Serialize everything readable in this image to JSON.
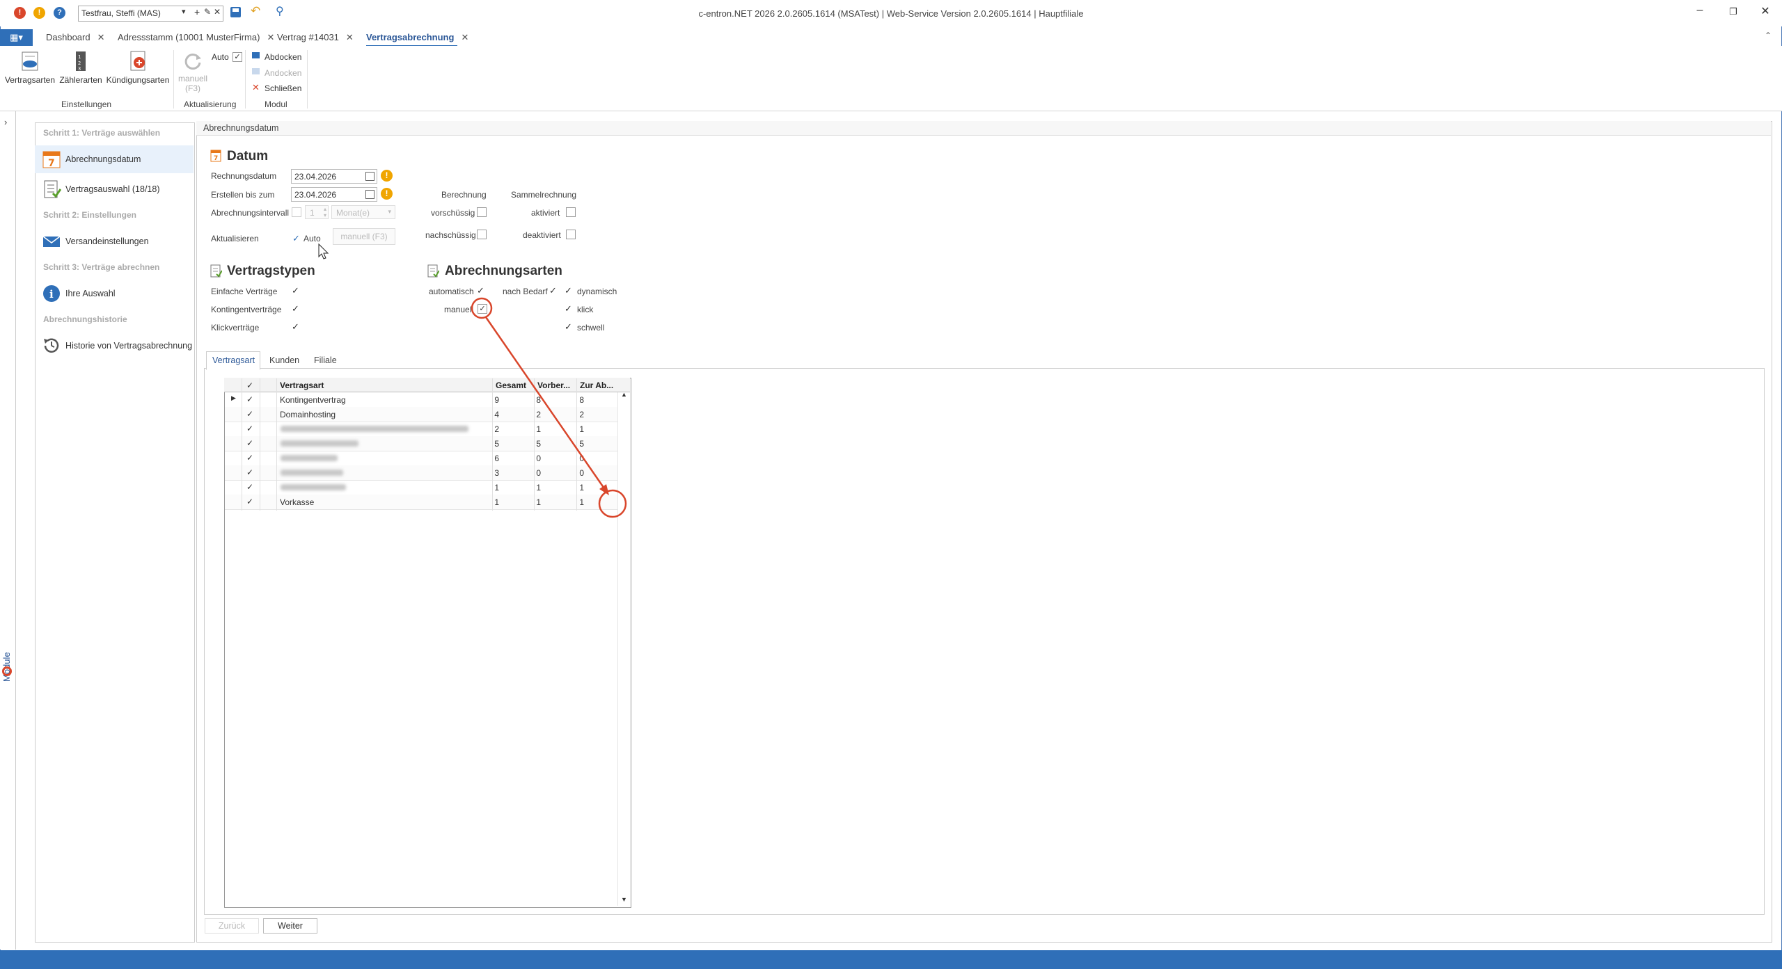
{
  "app": {
    "title": "c-entron.NET 2026 2.0.2605.1614 (MSATest) | Web-Service Version 2.0.2605.1614 | Hauptfiliale",
    "user_combo": "Testfrau, Steffi (MAS)"
  },
  "tabs": [
    {
      "label": "Dashboard"
    },
    {
      "label": "Adressstamm (10001 MusterFirma)"
    },
    {
      "label": "Vertrag #14031"
    },
    {
      "label": "Vertragsabrechnung"
    }
  ],
  "ribbon": {
    "einstellungen": {
      "group_label": "Einstellungen",
      "vertragsarten": "Vertragsarten",
      "zaehlerarten": "Zählerarten",
      "kuendigungsarten": "Kündigungsarten"
    },
    "aktualisierung": {
      "group_label": "Aktualisierung",
      "manuell": "manuell",
      "manuell_key": "(F3)",
      "auto": "Auto"
    },
    "modul": {
      "group_label": "Modul",
      "abdocken": "Abdocken",
      "andocken": "Andocken",
      "schliessen": "Schließen"
    }
  },
  "sidebar": {
    "module_label": "Module"
  },
  "nav": {
    "step1": "Schritt 1: Verträge auswählen",
    "abrechnungsdatum": "Abrechnungsdatum",
    "vertragsauswahl": "Vertragsauswahl (18/18)",
    "step2": "Schritt 2: Einstellungen",
    "versandeinstellungen": "Versandeinstellungen",
    "step3": "Schritt 3: Verträge abrechnen",
    "ihre_auswahl": "Ihre Auswahl",
    "historie_head": "Abrechnungshistorie",
    "historie": "Historie von Vertragsabrechnung"
  },
  "main": {
    "header": "Abrechnungsdatum",
    "datum": {
      "title": "Datum",
      "rechnungsdatum_label": "Rechnungsdatum",
      "rechnungsdatum": "23.04.2026",
      "erstellen_label": "Erstellen bis zum",
      "erstellen": "23.04.2026",
      "intervall_label": "Abrechnungsintervall",
      "intervall_value": "1",
      "intervall_unit": "Monat(e)",
      "aktualisieren_label": "Aktualisieren",
      "auto": "Auto",
      "manuell_btn": "manuell (F3)",
      "berechnung": "Berechnung",
      "vorschuessig": "vorschüssig",
      "nachschuessig": "nachschüssig",
      "sammelrechnung": "Sammelrechnung",
      "aktiviert": "aktiviert",
      "deaktiviert": "deaktiviert"
    },
    "vertragstypen": {
      "title": "Vertragstypen",
      "einfache": "Einfache Verträge",
      "kontingent": "Kontingentverträge",
      "klick": "Klickverträge"
    },
    "abrechnungsarten": {
      "title": "Abrechnungsarten",
      "automatisch": "automatisch",
      "manuell": "manuell",
      "nach_bedarf": "nach Bedarf",
      "dynamisch": "dynamisch",
      "klick": "klick",
      "schwell": "schwell"
    },
    "grid_tabs": [
      "Vertragsart",
      "Kunden",
      "Filiale"
    ],
    "grid": {
      "columns": [
        "Vertragsart",
        "Gesamt",
        "Vorber...",
        "Zur Ab..."
      ],
      "rows": [
        {
          "name": "Kontingentvertrag",
          "gesamt": "9",
          "vorber": "8",
          "zurab": "8"
        },
        {
          "name": "Domainhosting",
          "gesamt": "4",
          "vorber": "2",
          "zurab": "2"
        },
        {
          "name": "",
          "gesamt": "2",
          "vorber": "1",
          "zurab": "1"
        },
        {
          "name": "",
          "gesamt": "5",
          "vorber": "5",
          "zurab": "5"
        },
        {
          "name": "",
          "gesamt": "6",
          "vorber": "0",
          "zurab": "0"
        },
        {
          "name": "",
          "gesamt": "3",
          "vorber": "0",
          "zurab": "0"
        },
        {
          "name": "",
          "gesamt": "1",
          "vorber": "1",
          "zurab": "1"
        },
        {
          "name": "Vorkasse",
          "gesamt": "1",
          "vorber": "1",
          "zurab": "1"
        }
      ]
    },
    "buttons": {
      "zurueck": "Zurück",
      "weiter": "Weiter"
    }
  },
  "colors": {
    "accent": "#2f6fb8",
    "info": "#f0a500",
    "annotation": "#d9462b"
  }
}
